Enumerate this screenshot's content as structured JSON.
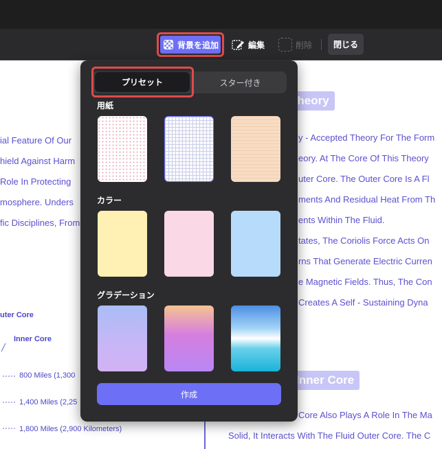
{
  "toolbar": {
    "add_background_label": "背景を追加",
    "edit_label": "編集",
    "delete_label": "削除",
    "close_label": "閉じる"
  },
  "panel": {
    "tabs": [
      {
        "label": "プリセット",
        "active": true
      },
      {
        "label": "スター付き",
        "active": false
      }
    ],
    "sections": [
      {
        "title": "用紙",
        "tiles": [
          "dot-paper",
          "grid-paper",
          "lined-paper"
        ]
      },
      {
        "title": "カラー",
        "tiles": [
          "yellow",
          "pink",
          "light-blue"
        ]
      },
      {
        "title": "グラデーション",
        "tiles": [
          "blue-purple-gradient",
          "orange-purple-gradient",
          "sky-sea-gradient"
        ]
      }
    ],
    "create_label": "作成"
  },
  "document": {
    "heading1": "Theory",
    "heading2": "e Inner Core",
    "left_lines": [
      "ial Feature Of Our",
      "hield Against Harm",
      " Role In Protecting",
      "mosphere. Unders",
      "fic Disciplines, From"
    ],
    "right_lines": [
      "y - Accepted Theory For The Form",
      "eory. At The Core Of This Theory",
      "uter Core. The Outer Core Is A Fl",
      "ments And Residual Heat From Th",
      "ents Within The Fluid.",
      "tates, The Coriolis Force Acts On",
      "rns That Generate Electric Curren",
      "e Magnetic Fields. Thus, The Con",
      "Creates A Self - Sustaining Dyna"
    ],
    "bottom_lines": [
      "Core Also Plays A Role In The Ma",
      "Solid, It Interacts With The Fluid Outer Core. The C"
    ],
    "diagram": {
      "outer_core": "uter Core",
      "inner_core": "Inner Core",
      "d1": "800 Miles (1,300",
      "d2": "1,400 Miles (2,25",
      "d3": "1,800 Miles (2,900 Kilometers)"
    }
  },
  "colors": {
    "accent": "#6d6ff5",
    "highlight": "#e04b4b",
    "panel_bg": "#2c2c2e",
    "doc_text": "#5b50cf"
  }
}
